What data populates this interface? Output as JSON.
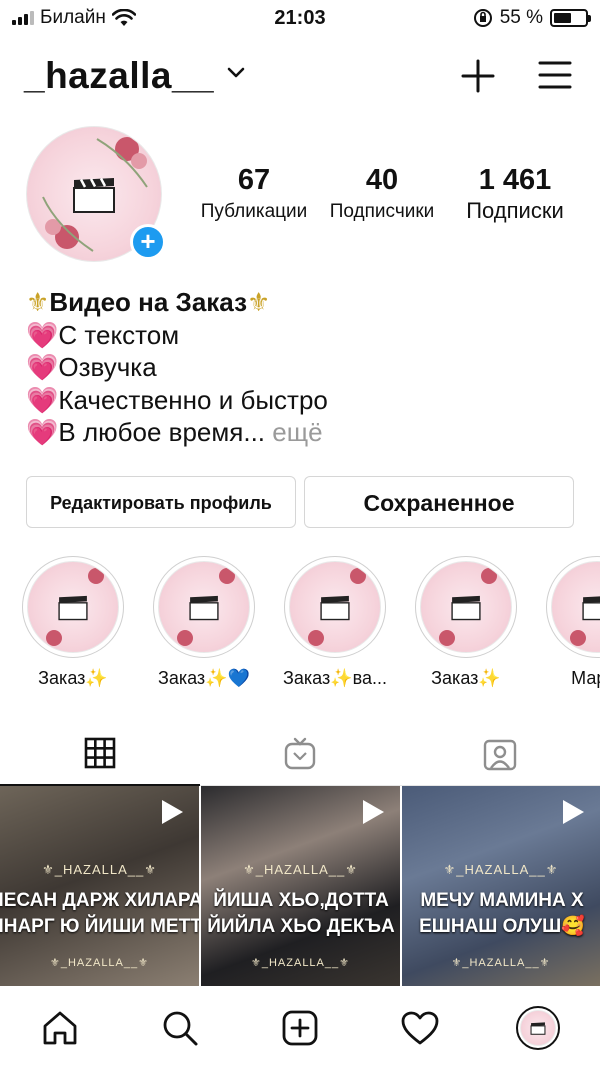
{
  "status": {
    "carrier": "Билайн",
    "time": "21:03",
    "battery": "55 %",
    "battery_level": 0.55
  },
  "header": {
    "username": "_hazalla__"
  },
  "stats": [
    {
      "value": "67",
      "label": "Публикации"
    },
    {
      "value": "40",
      "label": "Подписчики"
    },
    {
      "value": "1 461",
      "label": "Подписки"
    }
  ],
  "bio": {
    "title": "Видео на Заказ",
    "lines": [
      "С текстом",
      "Озвучка",
      "Качественно и быстро",
      "В любое время"
    ],
    "ellipsis": "...",
    "more": "ещё"
  },
  "buttons": {
    "edit": "Редактировать профиль",
    "saved": "Сохраненное"
  },
  "highlights": [
    {
      "label": "Заказ✨"
    },
    {
      "label": "Заказ✨💙"
    },
    {
      "label": "Заказ✨ва..."
    },
    {
      "label": "Заказ✨"
    },
    {
      "label": "Мар-д"
    }
  ],
  "posts": [
    {
      "watermark": "⚜_HAZALLA__⚜",
      "line1": "НЕСАН ДАРЖ ХИЛАРАХ",
      "line2": "ННАРГ Ю ЙИШИ МЕТТА",
      "watermark2": "⚜_HAZALLA__⚜"
    },
    {
      "watermark": "⚜_HAZALLA__⚜",
      "line1": "ЙИША ХЬО,ДОТТА",
      "line2": "ЙИЙЛА ХЬО ДЕКЪА",
      "watermark2": "⚜_HAZALLA__⚜"
    },
    {
      "watermark": "⚜_HAZALLA__⚜",
      "line1": "МЕЧУ МАМИНА Х",
      "line2": "ЕШНАШ ОЛУШ🥰",
      "watermark2": "⚜_HAZALLA__⚜"
    }
  ],
  "icons": {
    "header": [
      "chevron-down-icon",
      "plus-icon",
      "menu-icon"
    ],
    "tabs": [
      "grid-icon",
      "igtv-icon",
      "tagged-icon"
    ],
    "nav": [
      "home-icon",
      "search-icon",
      "add-post-icon",
      "heart-icon",
      "profile-avatar"
    ]
  },
  "colors": {
    "badge": "#1d9bf0",
    "bio_emoji": "#d63a8c",
    "more_text": "#9a9a9a"
  }
}
